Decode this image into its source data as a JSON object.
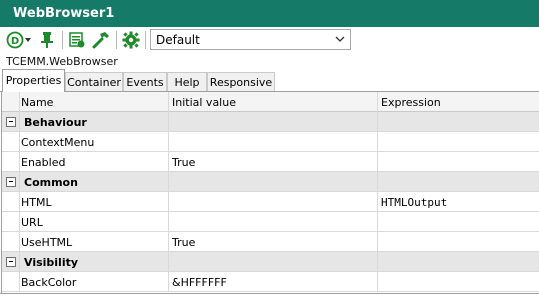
{
  "window": {
    "title": "WebBrowser1"
  },
  "toolbar": {
    "icons": [
      "designer-d-icon",
      "pin-icon",
      "properties-list-icon",
      "hammer-icon",
      "gear-icon"
    ],
    "dropdown": {
      "selected": "Default"
    }
  },
  "component_name": "TCEMM.WebBrowser",
  "tabs": [
    {
      "label": "Properties",
      "active": true
    },
    {
      "label": "Container",
      "active": false
    },
    {
      "label": "Events",
      "active": false
    },
    {
      "label": "Help",
      "active": false
    },
    {
      "label": "Responsive",
      "active": false
    }
  ],
  "grid": {
    "columns": [
      "Name",
      "Initial value",
      "Expression"
    ],
    "rows": [
      {
        "kind": "category",
        "name": "Behaviour",
        "value": "",
        "expression": ""
      },
      {
        "kind": "prop",
        "name": "ContextMenu",
        "value": "",
        "expression": ""
      },
      {
        "kind": "prop",
        "name": "Enabled",
        "value": "True",
        "expression": ""
      },
      {
        "kind": "category",
        "name": "Common",
        "value": "",
        "expression": ""
      },
      {
        "kind": "prop",
        "name": "HTML",
        "value": "",
        "expression": "HTMLOutput"
      },
      {
        "kind": "prop",
        "name": "URL",
        "value": "",
        "expression": ""
      },
      {
        "kind": "prop",
        "name": "UseHTML",
        "value": "True",
        "expression": ""
      },
      {
        "kind": "category",
        "name": "Visibility",
        "value": "",
        "expression": ""
      },
      {
        "kind": "prop",
        "name": "BackColor",
        "value": "&HFFFFFF",
        "expression": ""
      }
    ]
  },
  "colors": {
    "titlebar": "#167a68",
    "icon_green": "#1e8a2c"
  }
}
